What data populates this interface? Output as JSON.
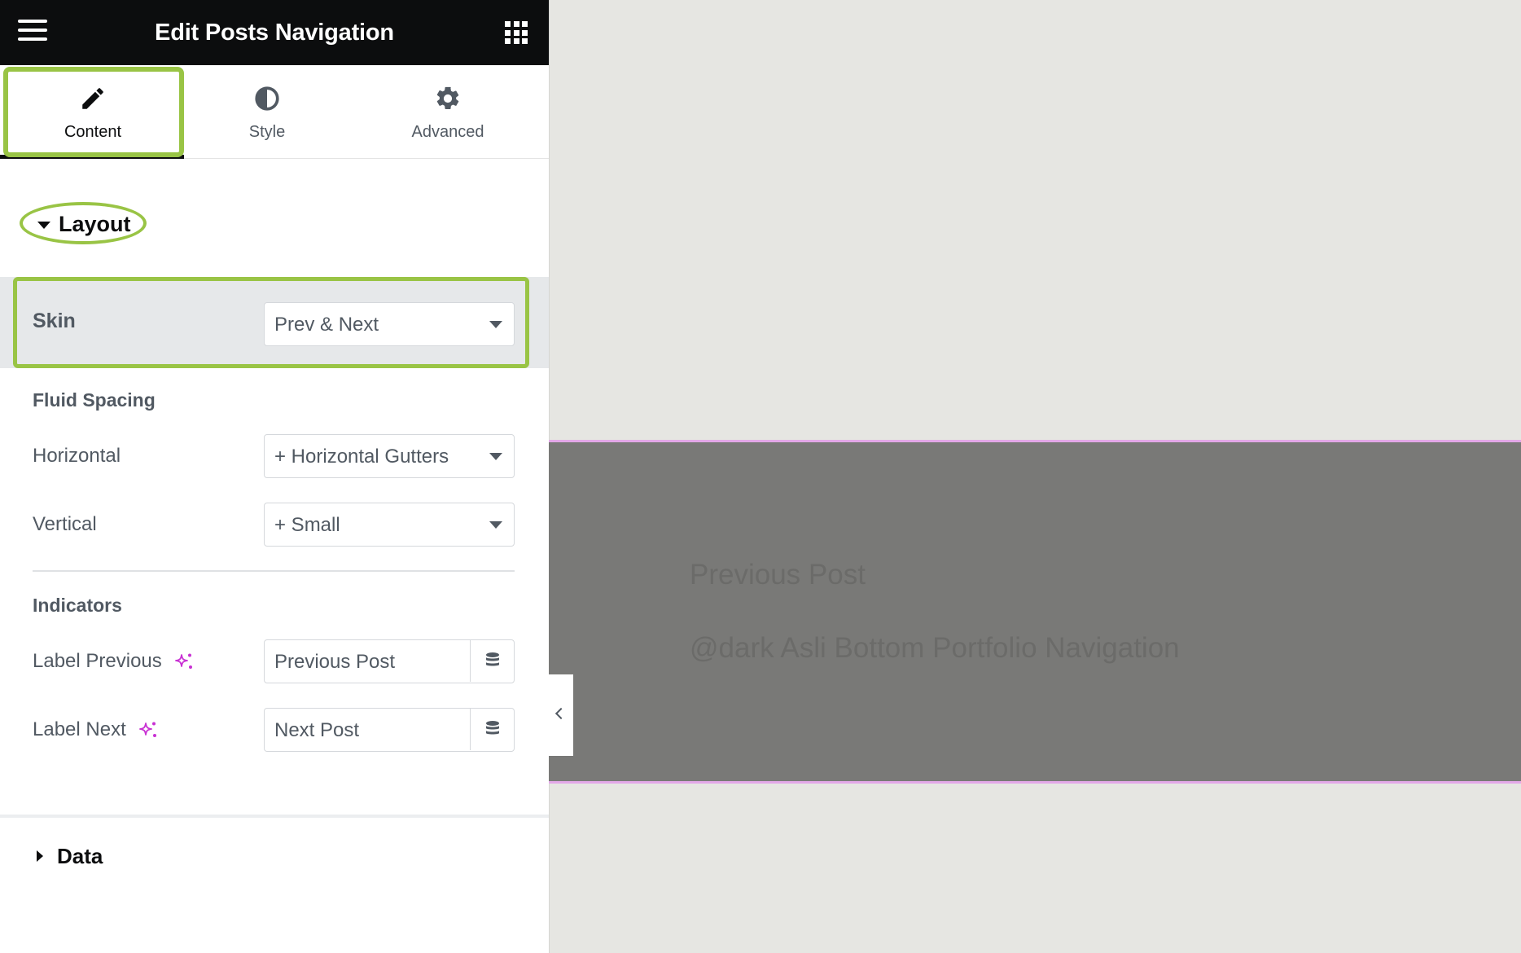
{
  "header": {
    "title": "Edit Posts Navigation",
    "menu_icon": "hamburger-icon",
    "apps_icon": "grid-icon"
  },
  "tabs": [
    {
      "label": "Content",
      "icon": "pencil-icon",
      "active": true
    },
    {
      "label": "Style",
      "icon": "half-circle-icon",
      "active": false
    },
    {
      "label": "Advanced",
      "icon": "gear-icon",
      "active": false
    }
  ],
  "layout_section": {
    "title": "Layout",
    "skin": {
      "label": "Skin",
      "value": "Prev & Next"
    },
    "fluid_spacing": {
      "title": "Fluid Spacing",
      "horizontal": {
        "label": "Horizontal",
        "value": "+ Horizontal Gutters"
      },
      "vertical": {
        "label": "Vertical",
        "value": "+ Small"
      }
    },
    "indicators": {
      "title": "Indicators",
      "label_previous": {
        "label": "Label Previous",
        "value": "Previous Post"
      },
      "label_next": {
        "label": "Label Next",
        "value": "Next Post"
      }
    }
  },
  "data_section": {
    "title": "Data"
  },
  "preview": {
    "previous_link": "Previous Post",
    "subtitle": "@dark Asli Bottom Portfolio Navigation"
  },
  "colors": {
    "highlight": "#99c445",
    "topbar": "#0c0d0e",
    "ai_accent": "#c831d3",
    "preview_band": "#797977",
    "band_border": "#e3a8e8"
  }
}
